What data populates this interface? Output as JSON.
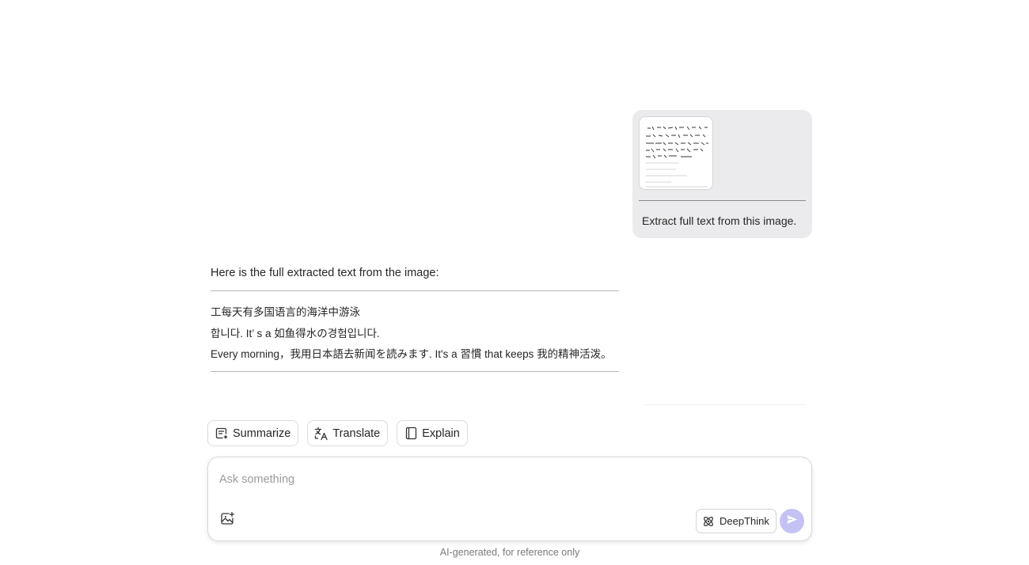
{
  "user_message": {
    "attachment_icon": "document-image-thumbnail",
    "text": "Extract full text from this image."
  },
  "assistant_message": {
    "intro": "Here is the full extracted text from the image:",
    "lines": [
      "工每天有多国语言的海洋中游泳",
      "합니다. It’ s a 如鱼得水の경험입니다.",
      "Every morning，我用日本語去新闻を読みます. It's a 習慣 that keeps 我的精神活泼。"
    ]
  },
  "actions": [
    {
      "label": "Summarize",
      "icon": "summarize-icon"
    },
    {
      "label": "Translate",
      "icon": "translate-icon"
    },
    {
      "label": "Explain",
      "icon": "book-icon"
    }
  ],
  "composer": {
    "placeholder": "Ask something",
    "value": "",
    "attach_icon": "image-upload-icon",
    "deepthink_label": "DeepThink",
    "deepthink_icon": "atom-icon",
    "send_icon": "send-icon"
  },
  "disclaimer": "AI-generated, for reference only",
  "colors": {
    "bubble_bg": "#ebebed",
    "send_button": "#c4c2f5",
    "text": "#262626",
    "muted": "#7a7a80"
  }
}
